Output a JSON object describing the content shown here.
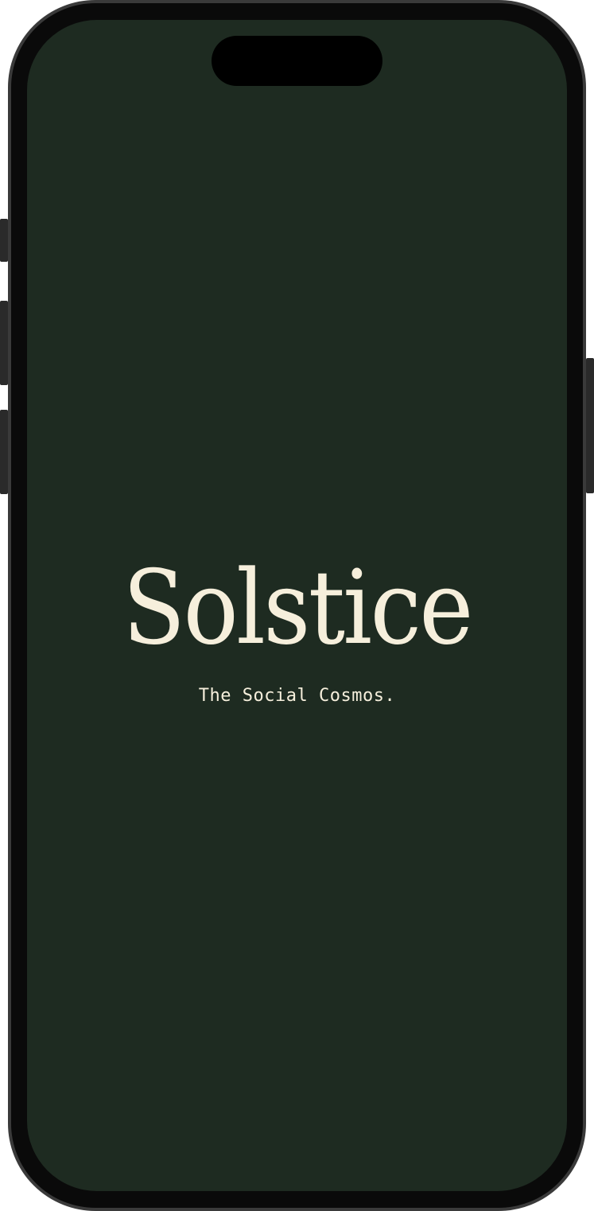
{
  "app": {
    "name": "Solstice",
    "tagline": "The Social Cosmos."
  },
  "theme": {
    "background": "#1e2b21",
    "text": "#f6efdc"
  }
}
